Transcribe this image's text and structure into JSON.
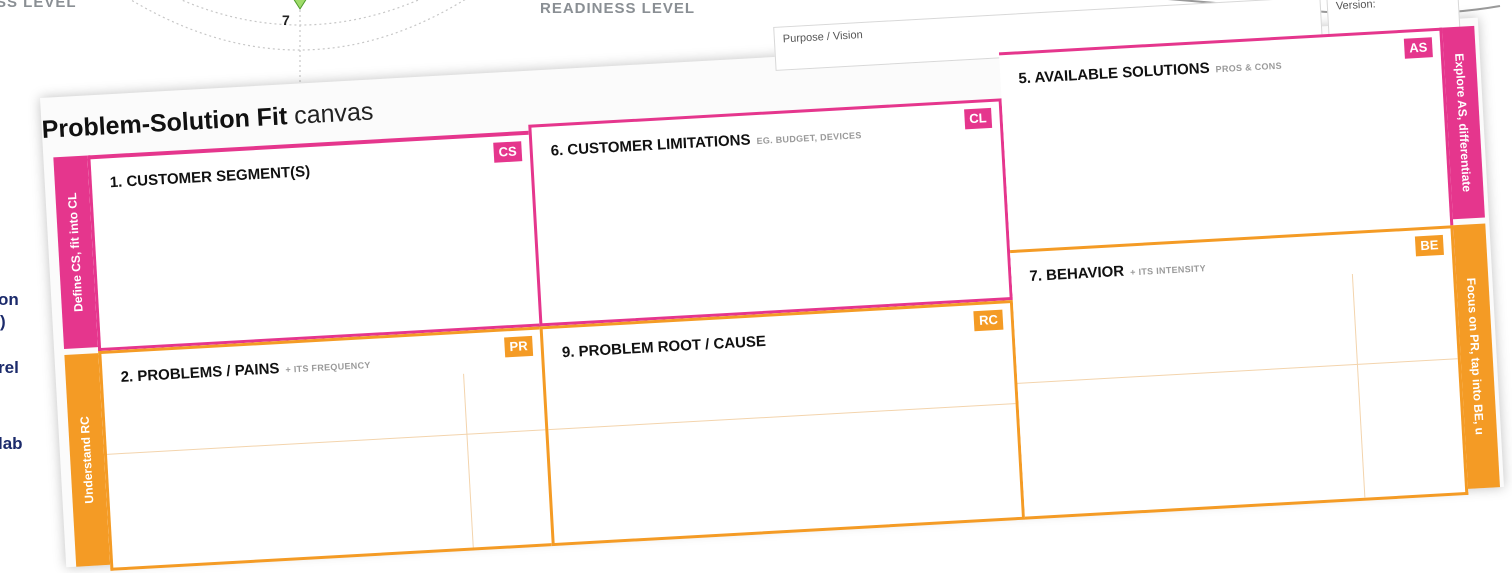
{
  "background": {
    "left_level": "SS LEVEL",
    "readiness_level": "READINESS LEVEL",
    "digit": "7",
    "blue_fragments": [
      "on",
      ")",
      "rel",
      "lab"
    ]
  },
  "canvas": {
    "purpose_label": "Purpose / Vision",
    "version_label": "Version:",
    "title_bold": "Problem-Solution Fit",
    "title_light": " canvas",
    "side_bands": {
      "left_top": "Define CS, fit into CL",
      "left_bottom": "Understand RC",
      "right_top": "Explore AS, differentiate",
      "right_bottom": "Focus on PR, tap into BE, u"
    },
    "cells": {
      "cs": {
        "title": "1. CUSTOMER SEGMENT(S)",
        "subtitle": "",
        "tag": "CS"
      },
      "cl": {
        "title": "6. CUSTOMER LIMITATIONS",
        "subtitle": "EG. BUDGET, DEVICES",
        "tag": "CL"
      },
      "as": {
        "title": "5. AVAILABLE SOLUTIONS",
        "subtitle": "PROS & CONS",
        "tag": "AS"
      },
      "pr": {
        "title": "2. PROBLEMS / PAINS",
        "subtitle": "+ ITS FREQUENCY",
        "tag": "PR"
      },
      "rc": {
        "title": "9. PROBLEM ROOT / CAUSE",
        "subtitle": "",
        "tag": "RC"
      },
      "be": {
        "title": "7. BEHAVIOR",
        "subtitle": "+ ITS INTENSITY",
        "tag": "BE"
      }
    }
  },
  "colors": {
    "pink": "#e5368d",
    "orange": "#f49b25",
    "blue_text": "#1b2a6b"
  }
}
